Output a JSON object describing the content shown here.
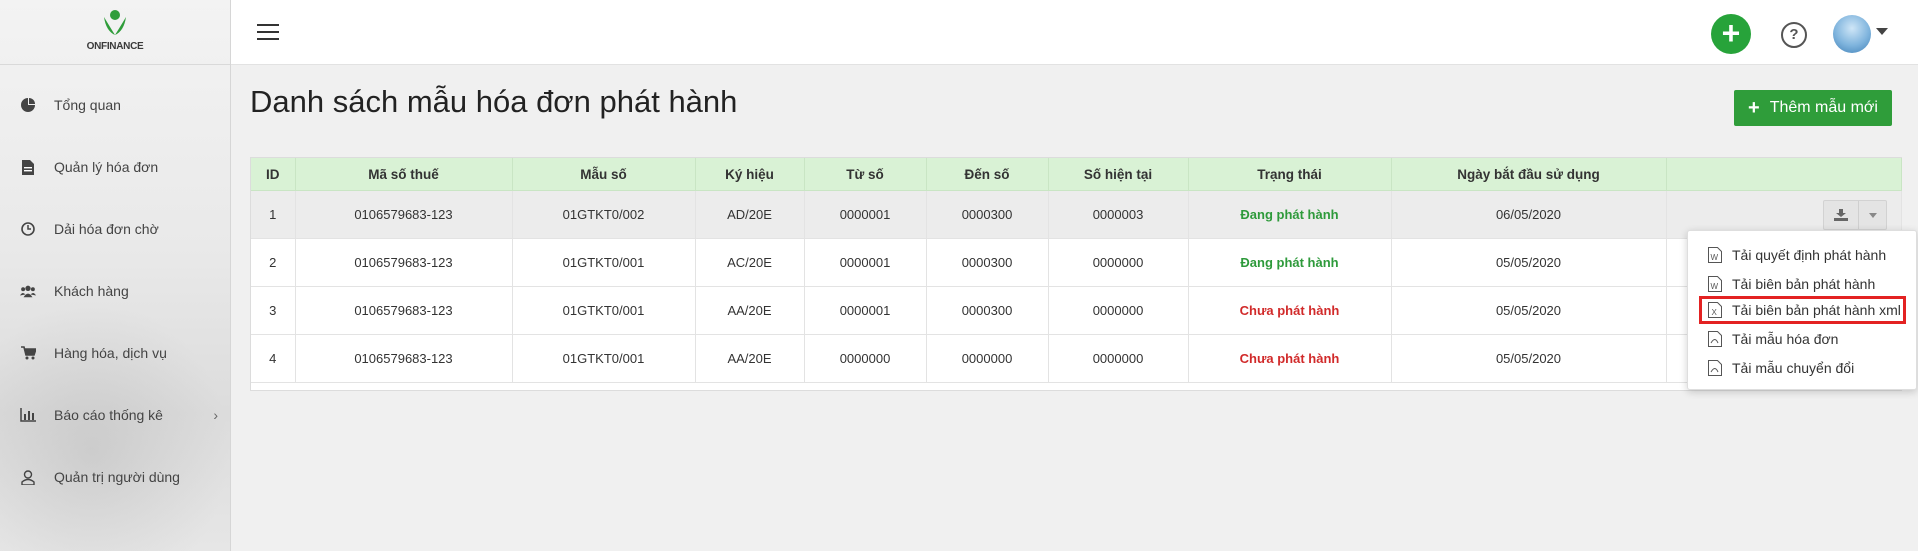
{
  "app": {
    "logo_text": "ONFINANCE"
  },
  "sidebar": {
    "items": [
      {
        "label": "Tổng quan",
        "icon": "pie-chart-icon"
      },
      {
        "label": "Quản lý hóa đơn",
        "icon": "document-icon"
      },
      {
        "label": "Dải hóa đơn chờ",
        "icon": "clock-icon"
      },
      {
        "label": "Khách hàng",
        "icon": "users-icon"
      },
      {
        "label": "Hàng hóa, dịch vụ",
        "icon": "cart-icon"
      },
      {
        "label": "Báo cáo thống kê",
        "icon": "bar-chart-icon",
        "chevron": "›"
      },
      {
        "label": "Quản trị người dùng",
        "icon": "user-icon"
      }
    ]
  },
  "header": {
    "plus": "+",
    "help": "?"
  },
  "main": {
    "title": "Danh sách mẫu hóa đơn phát hành",
    "add_button": {
      "icon": "+",
      "label": "Thêm mẫu mới"
    },
    "table": {
      "columns": [
        "ID",
        "Mã số thuế",
        "Mẫu số",
        "Ký hiệu",
        "Từ số",
        "Đến số",
        "Số hiện tại",
        "Trạng thái",
        "Ngày bắt đầu sử dụng",
        ""
      ],
      "rows": [
        [
          "1",
          "0106579683-123",
          "01GTKT0/002",
          "AD/20E",
          "0000001",
          "0000300",
          "0000003",
          "Đang phát hành",
          "06/05/2020"
        ],
        [
          "2",
          "0106579683-123",
          "01GTKT0/001",
          "AC/20E",
          "0000001",
          "0000300",
          "0000000",
          "Đang phát hành",
          "05/05/2020"
        ],
        [
          "3",
          "0106579683-123",
          "01GTKT0/001",
          "AA/20E",
          "0000001",
          "0000300",
          "0000000",
          "Chưa phát hành",
          "05/05/2020"
        ],
        [
          "4",
          "0106579683-123",
          "01GTKT0/001",
          "AA/20E",
          "0000000",
          "0000000",
          "0000000",
          "Chưa phát hành",
          "05/05/2020"
        ]
      ]
    },
    "dropdown": {
      "items": [
        {
          "label": "Tải quyết định phát hành",
          "icon": "word-file-icon"
        },
        {
          "label": "Tải biên bản phát hành",
          "icon": "word-file-icon"
        },
        {
          "label": "Tải biên bản phát hành xml",
          "icon": "xml-file-icon"
        },
        {
          "label": "Tải mẫu hóa đơn",
          "icon": "pdf-file-icon"
        },
        {
          "label": "Tải mẫu chuyển đổi",
          "icon": "pdf-file-icon"
        }
      ]
    }
  },
  "colors": {
    "accent_green": "#2f9d3a",
    "status_active": "#2e9a3b",
    "status_inactive": "#d12a2a",
    "header_green": "#d9f2d5",
    "highlight_red": "#e32222"
  }
}
